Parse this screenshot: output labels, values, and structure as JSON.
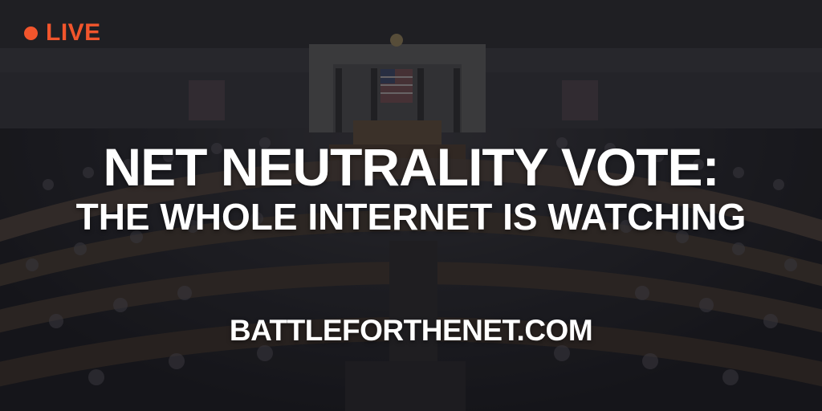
{
  "badge": {
    "label": "LIVE",
    "dot_icon": "live-dot-icon",
    "color": "#f2552c"
  },
  "headline": {
    "line1": "NET NEUTRALITY VOTE:",
    "line2": "THE WHOLE INTERNET IS WATCHING"
  },
  "url": "BATTLEFORTHENET.COM",
  "colors": {
    "accent": "#f2552c",
    "text": "#ffffff",
    "background": "#2a2a2f"
  }
}
